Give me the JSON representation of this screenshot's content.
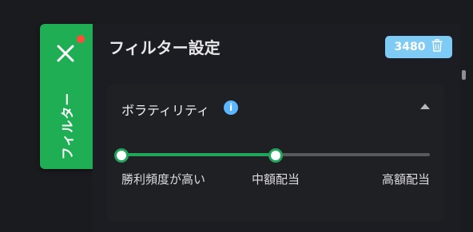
{
  "filter_tab": {
    "label": "フィルター",
    "close_icon": "close-icon",
    "notification_color": "#ff4d3a",
    "background": "#1fae54"
  },
  "panel": {
    "title": "フィルター設定",
    "result_count": "3480",
    "clear_icon": "trash-icon",
    "badge_color": "#7ecbf5"
  },
  "volatility": {
    "title": "ボラティリティ",
    "info_icon_glyph": "i",
    "collapse_icon": "chevron-up-icon",
    "slider": {
      "stops": [
        "勝利頻度が高い",
        "中額配当",
        "高額配当"
      ],
      "range_start": 0,
      "range_end": 0.5,
      "accent": "#22a55a"
    }
  }
}
